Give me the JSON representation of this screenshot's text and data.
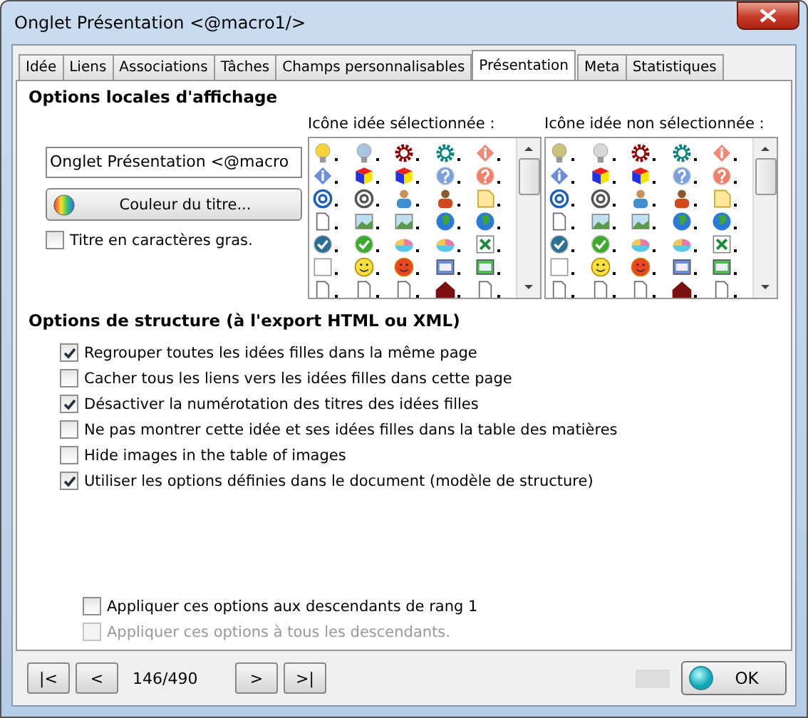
{
  "window": {
    "title": "Onglet Présentation <@macro1/>"
  },
  "tabs": [
    {
      "label": "Idée",
      "selected": false
    },
    {
      "label": "Liens",
      "selected": false
    },
    {
      "label": "Associations",
      "selected": false
    },
    {
      "label": "Tâches",
      "selected": false
    },
    {
      "label": "Champs personnalisables",
      "selected": false
    },
    {
      "label": "Présentation",
      "selected": true
    },
    {
      "label": "Meta",
      "selected": false
    },
    {
      "label": "Statistiques",
      "selected": false
    }
  ],
  "local_options": {
    "title": "Options locales d'affichage",
    "title_field": {
      "value": "Onglet Présentation <@macro"
    },
    "color_button": {
      "label": "Couleur du titre..."
    },
    "bold_checkbox": {
      "label": "Titre en caractères gras.",
      "checked": false
    },
    "icon_lists": [
      {
        "label": "Icône idée sélectionnée :"
      },
      {
        "label": "Icône idée non sélectionnée :"
      }
    ]
  },
  "structure_options": {
    "title": "Options de structure (à l'export HTML ou XML)",
    "options": [
      {
        "label": "Regrouper toutes les idées filles dans la même page",
        "checked": true
      },
      {
        "label": "Cacher tous les liens vers les idées filles dans cette page",
        "checked": false
      },
      {
        "label": "Désactiver la numérotation des titres des idées filles",
        "checked": true
      },
      {
        "label": "Ne pas montrer cette idée et ses idées filles dans la table des matières",
        "checked": false
      },
      {
        "label": "Hide images in the table of images",
        "checked": false
      },
      {
        "label": "Utiliser les options définies dans le document (modèle de structure)",
        "checked": true
      }
    ]
  },
  "apply_options": [
    {
      "label": "Appliquer ces options aux descendants de rang 1",
      "checked": false,
      "disabled": false
    },
    {
      "label": "Appliquer ces options à tous les descendants.",
      "checked": false,
      "disabled": true
    }
  ],
  "navigation": {
    "buttons": [
      {
        "label": "|<"
      },
      {
        "label": "<"
      }
    ],
    "counter": "146/490",
    "buttons_after": [
      {
        "label": ">"
      },
      {
        "label": ">|"
      }
    ]
  },
  "ok_button": {
    "label": "OK"
  }
}
